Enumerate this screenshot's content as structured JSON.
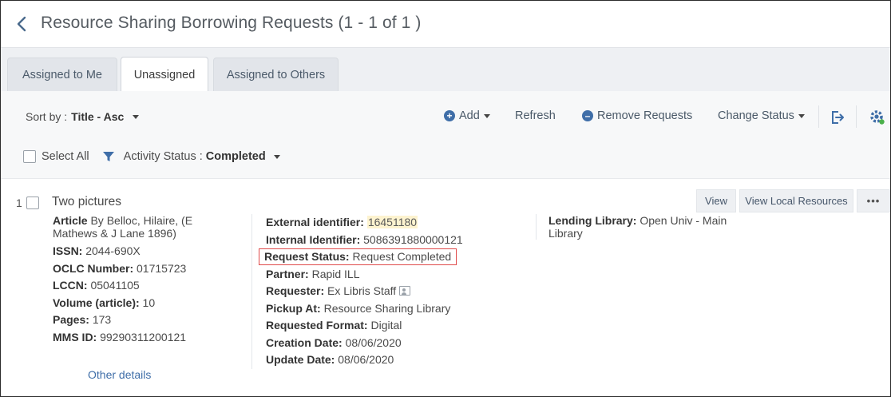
{
  "header": {
    "title": "Resource Sharing Borrowing Requests (1 - 1 of 1 )"
  },
  "tabs": [
    {
      "label": "Assigned to Me"
    },
    {
      "label": "Unassigned"
    },
    {
      "label": "Assigned to Others"
    }
  ],
  "toolbar": {
    "sort_prefix": "Sort by :",
    "sort_value": "Title - Asc",
    "add_label": "Add",
    "refresh_label": "Refresh",
    "remove_label": "Remove Requests",
    "change_status_label": "Change Status",
    "select_all_label": "Select All",
    "activity_prefix": "Activity Status :",
    "activity_value": "Completed"
  },
  "record": {
    "number": "1",
    "title": "Two pictures",
    "article_label": "Article",
    "article_text": "By Belloc, Hilaire, (E Mathews & J Lane 1896)",
    "issn_label": "ISSN:",
    "issn": "2044-690X",
    "oclc_label": "OCLC Number:",
    "oclc": "01715723",
    "lccn_label": "LCCN:",
    "lccn": "05041105",
    "volume_label": "Volume (article):",
    "volume": "10",
    "pages_label": "Pages:",
    "pages": "173",
    "mms_label": "MMS ID:",
    "mms": "99290311200121",
    "external_label": "External identifier:",
    "external": "16451180",
    "internal_label": "Internal Identifier:",
    "internal": "5086391880000121",
    "status_label": "Request Status:",
    "status": "Request Completed",
    "partner_label": "Partner:",
    "partner": "Rapid ILL",
    "requester_label": "Requester:",
    "requester": "Ex Libris Staff",
    "pickup_label": "Pickup At:",
    "pickup": "Resource Sharing Library",
    "format_label": "Requested Format:",
    "format": "Digital",
    "creation_label": "Creation Date:",
    "creation": "08/06/2020",
    "update_label": "Update Date:",
    "update": "08/06/2020",
    "lending_label": "Lending Library:",
    "lending": "Open Univ - Main Library",
    "other_details": "Other details",
    "view_label": "View",
    "view_local_label": "View Local Resources",
    "more_label": "•••"
  },
  "colors": {
    "accent": "#3f6ea8",
    "status_box": "#e04b4b",
    "highlight": "#fdf3cf"
  }
}
